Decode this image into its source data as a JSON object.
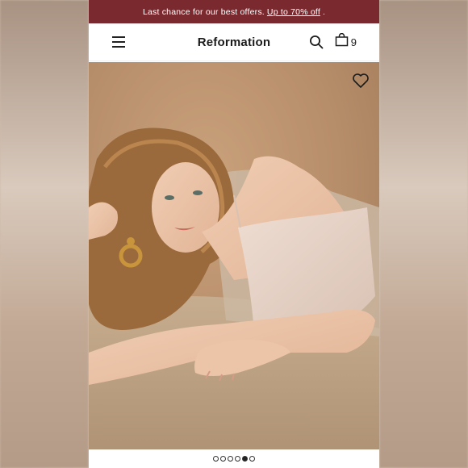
{
  "promo": {
    "text": "Last chance for our best offers.",
    "link": "Up to 70% off",
    "suffix": "."
  },
  "header": {
    "brand": "Reformation",
    "bag_count": "9"
  },
  "icons": {
    "menu": "hamburger-icon",
    "search": "search-icon",
    "bag": "shopping-bag-icon",
    "wishlist": "heart-icon"
  },
  "carousel": {
    "total": 6,
    "active_index": 4
  },
  "colors": {
    "promo_bg": "#7a2a2f",
    "photo_bg": "#b88f6b"
  }
}
